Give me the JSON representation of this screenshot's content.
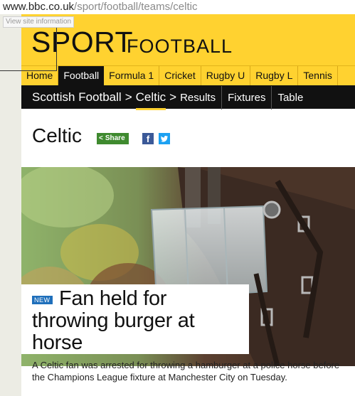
{
  "browser": {
    "url_host": "www.bbc.co.uk",
    "url_path": "/sport/football/teams/celtic",
    "tooltip": "View site information"
  },
  "masthead": {
    "sport": "SPORT",
    "section": "FOOTBALL",
    "background_color": "#ffd230"
  },
  "main_nav": {
    "items": [
      {
        "label": "Home"
      },
      {
        "label": "Football",
        "active": true
      },
      {
        "label": "Formula 1"
      },
      {
        "label": "Cricket"
      },
      {
        "label": "Rugby U"
      },
      {
        "label": "Rugby L"
      },
      {
        "label": "Tennis"
      }
    ]
  },
  "sub_nav": {
    "crumbs": [
      "Scottish Football",
      "Celtic"
    ],
    "separator": ">",
    "links": [
      "Results",
      "Fixtures",
      "Table"
    ]
  },
  "page": {
    "title": "Celtic",
    "share_label": "Share",
    "facebook_glyph": "f",
    "twitter_glyph": "🐦"
  },
  "story": {
    "badge": "NEW",
    "headline": "Fan held for throwing burger at horse",
    "summary": "A Celtic fan was arrested for throwing a hamburger at a police horse before the Champions League fixture at Manchester City on Tuesday.",
    "image_subject": "police-horse-with-visor-photo"
  }
}
